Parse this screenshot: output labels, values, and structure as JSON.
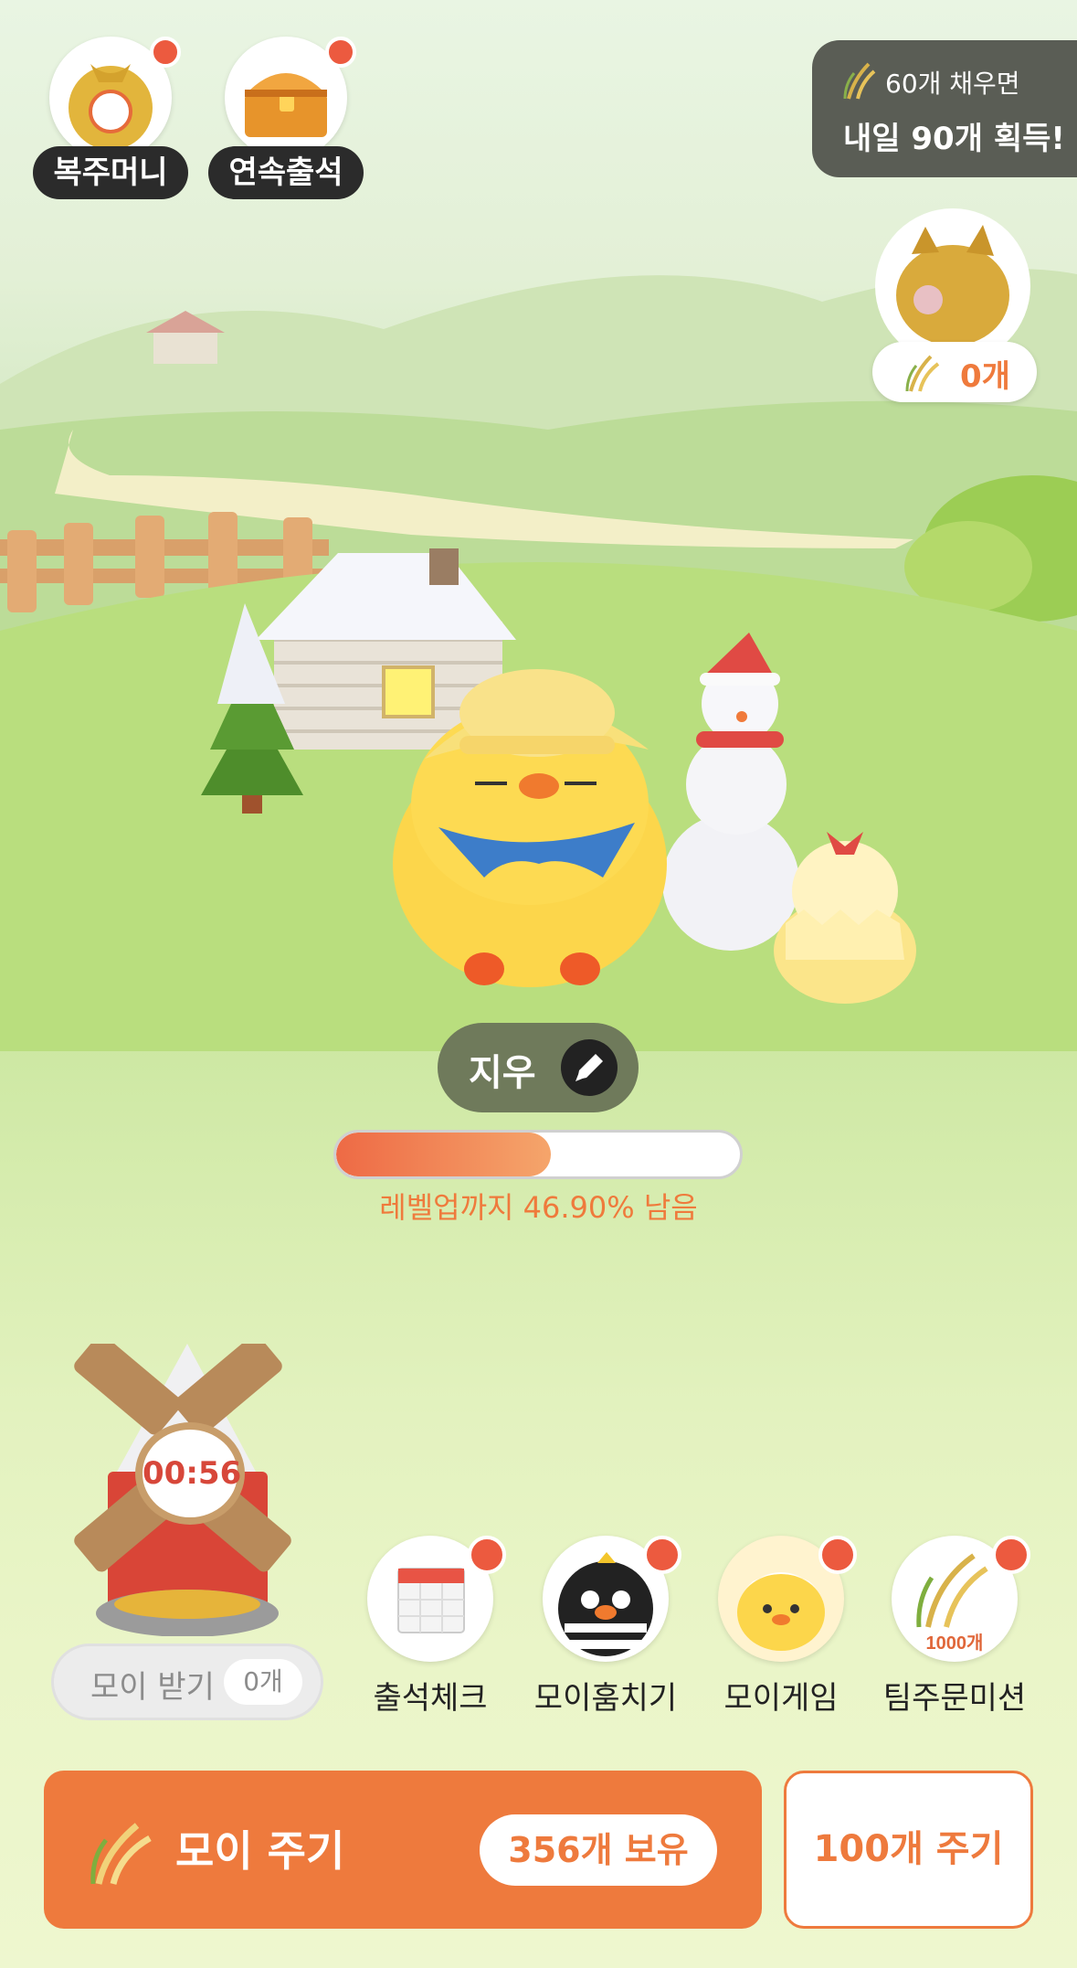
{
  "top_buttons": {
    "lucky_bag": {
      "label": "복주머니"
    },
    "attendance_streak": {
      "label": "연속출석"
    }
  },
  "mission": {
    "line1": "60개 채우면",
    "line2": "내일 90개 획득!"
  },
  "piggy_bank": {
    "count": "0개"
  },
  "pet": {
    "name": "지우"
  },
  "level": {
    "progress_percent": 53.1,
    "text": "레벨업까지 46.90% 남음"
  },
  "windmill": {
    "timer": "00:56",
    "receive_label": "모이 받기",
    "receive_count": "0개"
  },
  "quick_menu": [
    {
      "label": "출석체크",
      "icon": "calendar-icon"
    },
    {
      "label": "모이훔치기",
      "icon": "thief-chick-icon"
    },
    {
      "label": "모이게임",
      "icon": "chick-game-icon"
    },
    {
      "label": "팀주문미션",
      "icon": "rice-1000-icon",
      "badge": "1000개"
    }
  ],
  "bottom_bar": {
    "give_label": "모이 주기",
    "owned": "356개 보유",
    "give_100": "100개 주기"
  },
  "colors": {
    "accent": "#ee7a3d",
    "badge_red": "#ec5a3f",
    "dark_pill": "#2b2b2b"
  }
}
